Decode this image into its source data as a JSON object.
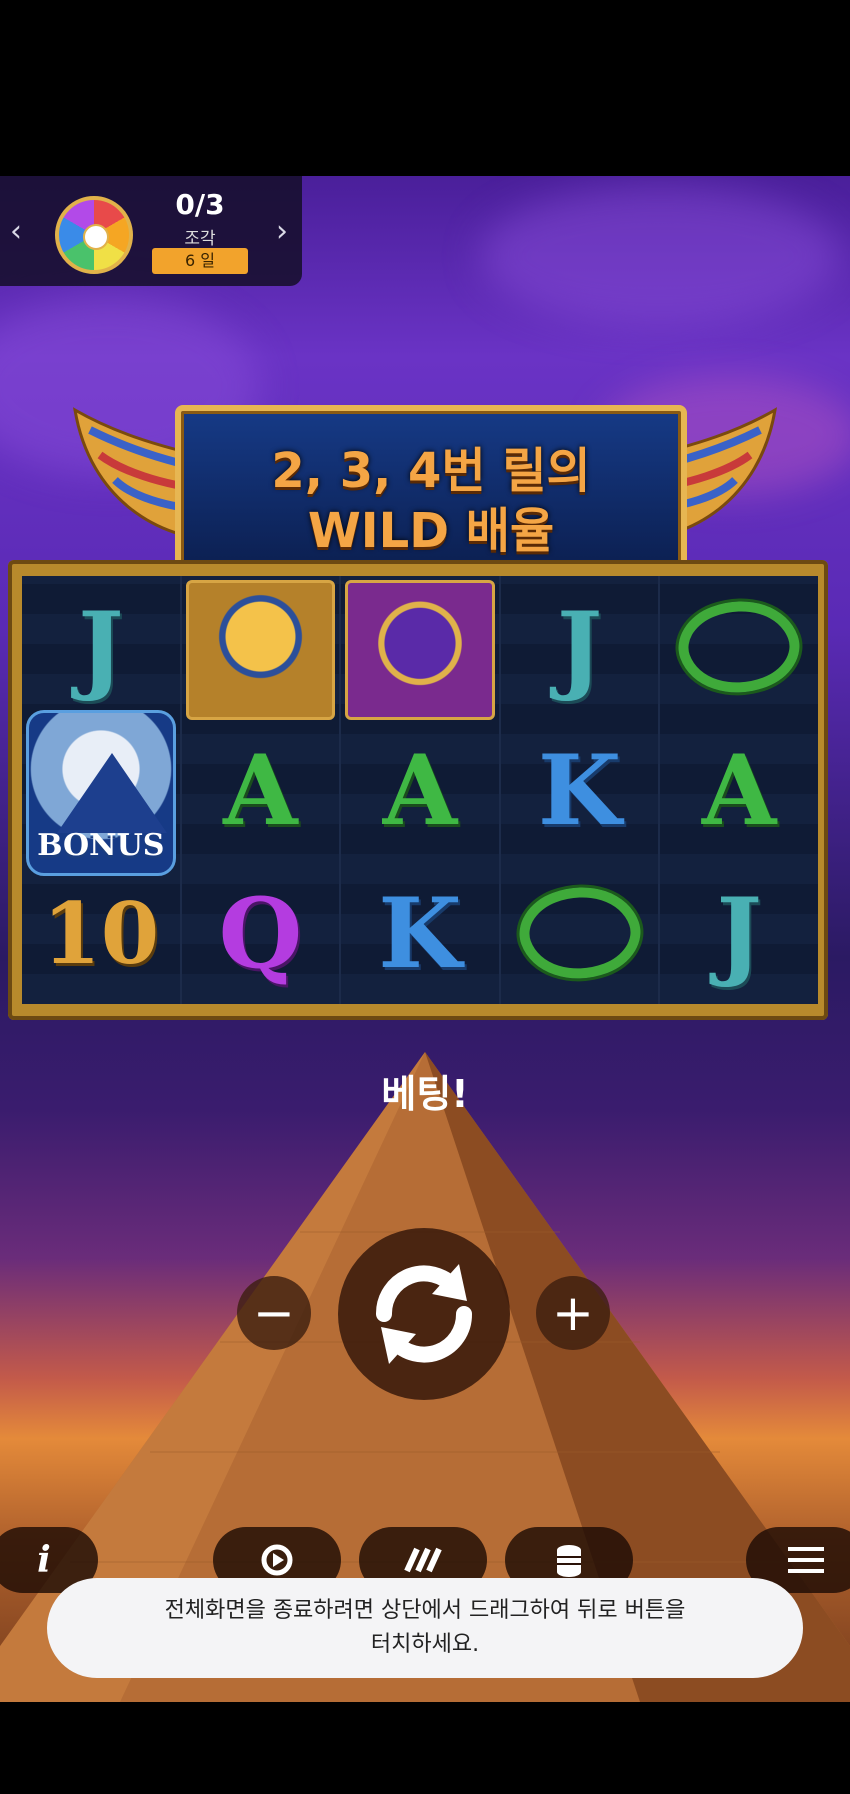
{
  "piece_panel": {
    "count": "0/3",
    "label": "조각",
    "days": "6 일"
  },
  "banner": {
    "line1": "2, 3, 4번 릴의",
    "line2": "WILD 배율"
  },
  "reels": [
    [
      {
        "type": "letter",
        "text": "J",
        "cls": "J"
      },
      {
        "type": "bonus",
        "text": "BONUS"
      },
      {
        "type": "letter",
        "text": "10",
        "cls": "10"
      }
    ],
    [
      {
        "type": "pharaoh"
      },
      {
        "type": "letter",
        "text": "A",
        "cls": "A"
      },
      {
        "type": "letter",
        "text": "Q",
        "cls": "Q"
      }
    ],
    [
      {
        "type": "anubis"
      },
      {
        "type": "letter",
        "text": "A",
        "cls": "A"
      },
      {
        "type": "letter",
        "text": "K",
        "cls": "K"
      }
    ],
    [
      {
        "type": "letter",
        "text": "J",
        "cls": "J"
      },
      {
        "type": "letter",
        "text": "K",
        "cls": "K"
      },
      {
        "type": "snake"
      }
    ],
    [
      {
        "type": "snake"
      },
      {
        "type": "letter",
        "text": "A",
        "cls": "A"
      },
      {
        "type": "letter",
        "text": "J",
        "cls": "J"
      }
    ]
  ],
  "bet_text": "베팅!",
  "controls": {
    "minus_label": "−",
    "plus_label": "+",
    "info_label": "i"
  },
  "toast": {
    "line1": "전체화면을 종료하려면 상단에서 드래그하여 뒤로 버튼을",
    "line2": "터치하세요."
  },
  "icons": {
    "left": "chevron-left-icon",
    "right": "chevron-right-icon",
    "wheel": "prize-wheel-icon",
    "spin": "spin-arrows-icon",
    "autoplay": "autoplay-icon",
    "turbo": "turbo-icon",
    "coins": "coins-stack-icon",
    "menu": "hamburger-menu-icon"
  }
}
